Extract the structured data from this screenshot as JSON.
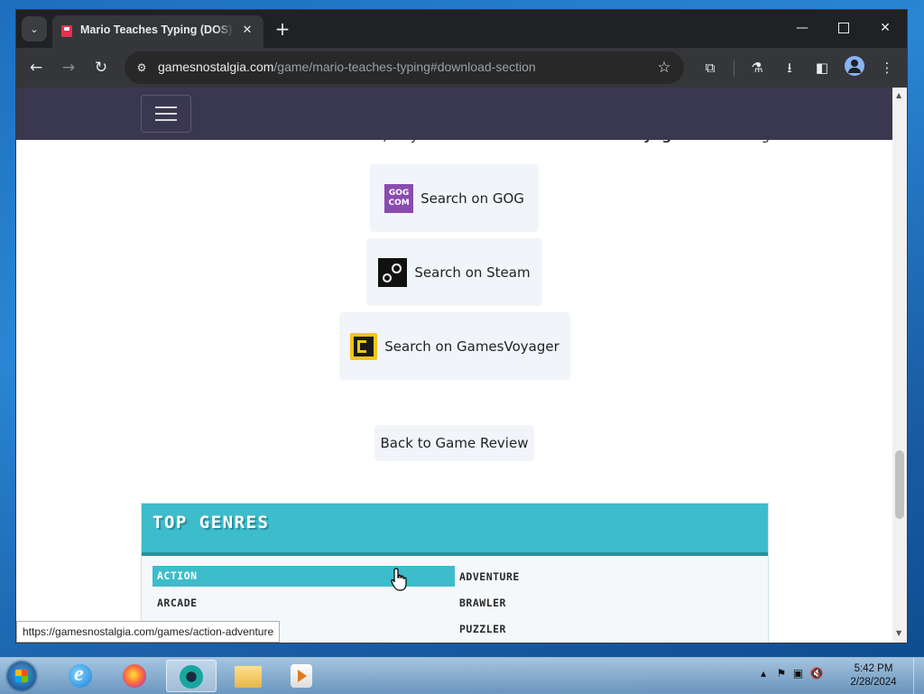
{
  "browser": {
    "tab_title": "Mario Teaches Typing (DOS) Game",
    "url_host": "gamesnostalgia.com",
    "url_path": "/game/mario-teaches-typing#download-section",
    "new_tab": "+",
    "tab_close": "✕",
    "tab_list": "⌄"
  },
  "page": {
    "cut_text_pre": "available on ",
    "cut_text_gog": "GOG",
    "cut_text_or": " or ",
    "cut_text_steam": "Steam",
    "cut_text_mid": ", or you can search on the ",
    "cut_text_voyager": "GamesVoyager",
    "cut_text_post": " search engine.",
    "store_buttons": [
      {
        "label": "Search on GOG",
        "icon": "gog-logo",
        "logo_text": [
          "GOG",
          "COM"
        ]
      },
      {
        "label": "Search on Steam",
        "icon": "steam-logo"
      },
      {
        "label": "Search on GamesVoyager",
        "icon": "gamesvoyager-logo"
      }
    ],
    "back_label": "Back to Game Review",
    "genres": {
      "title": "TOP GENRES",
      "items": [
        "ACTION",
        "ADVENTURE",
        "ARCADE",
        "BRAWLER",
        "PUZZLER"
      ],
      "active": "ACTION"
    }
  },
  "status_bar_url": "https://gamesnostalgia.com/games/action-adventure",
  "taskbar": {
    "time": "5:42 PM",
    "date": "2/28/2024"
  },
  "colors": {
    "nav_bg": "#3a3750",
    "genre_accent": "#3dbccc",
    "chrome_dark": "#202124"
  }
}
